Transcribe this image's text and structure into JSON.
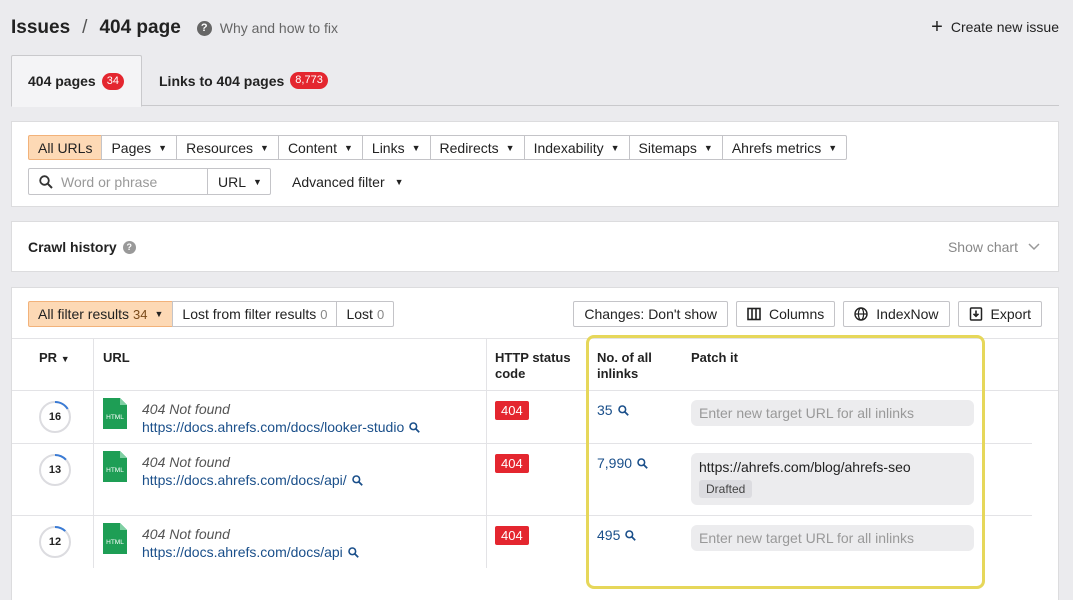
{
  "breadcrumb": {
    "root": "Issues",
    "separator": "/",
    "current": "404 page"
  },
  "help": {
    "icon": "help-circle-icon",
    "label": "Why and how to fix"
  },
  "create_issue": {
    "icon": "plus-icon",
    "label": "Create new issue"
  },
  "tabs": [
    {
      "label": "404 pages",
      "count": "34",
      "active": true
    },
    {
      "label": "Links to 404 pages",
      "count": "8,773",
      "active": false
    }
  ],
  "filters": {
    "buttons": [
      {
        "label": "All URLs",
        "selected": true,
        "caret": false
      },
      {
        "label": "Pages",
        "caret": true
      },
      {
        "label": "Resources",
        "caret": true
      },
      {
        "label": "Content",
        "caret": true
      },
      {
        "label": "Links",
        "caret": true
      },
      {
        "label": "Redirects",
        "caret": true
      },
      {
        "label": "Indexability",
        "caret": true
      },
      {
        "label": "Sitemaps",
        "caret": true
      },
      {
        "label": "Ahrefs metrics",
        "caret": true
      }
    ],
    "search_placeholder": "Word or phrase",
    "search_scope": "URL",
    "advanced_filter": "Advanced filter"
  },
  "crawl_history": {
    "title": "Crawl history",
    "show_chart": "Show chart"
  },
  "results": {
    "segments": [
      {
        "label": "All filter results",
        "count": "34",
        "selected": true
      },
      {
        "label": "Lost from filter results",
        "count": "0"
      },
      {
        "label": "Lost",
        "count": "0"
      }
    ],
    "tools": {
      "changes": "Changes: Don't show",
      "columns": "Columns",
      "indexnow": "IndexNow",
      "export": "Export"
    },
    "columns": {
      "pr": "PR",
      "url": "URL",
      "http_status_line1": "HTTP status",
      "http_status_line2": "code",
      "inlinks_line1": "No. of all",
      "inlinks_line2": "inlinks",
      "patch": "Patch it"
    },
    "rows": [
      {
        "pr": "16",
        "pr_fraction": 0.16,
        "file_type": "HTML",
        "status_text": "404 Not found",
        "url": "https://docs.ahrefs.com/docs/looker-studio",
        "code": "404",
        "inlinks": "35",
        "patch_placeholder": "Enter new target URL for all inlinks"
      },
      {
        "pr": "13",
        "pr_fraction": 0.13,
        "file_type": "HTML",
        "status_text": "404 Not found",
        "url": "https://docs.ahrefs.com/docs/api/",
        "code": "404",
        "inlinks": "7,990",
        "patch_value": "https://ahrefs.com/blog/ahrefs-seo",
        "patch_badge": "Drafted"
      },
      {
        "pr": "12",
        "pr_fraction": 0.12,
        "file_type": "HTML",
        "status_text": "404 Not found",
        "url": "https://docs.ahrefs.com/docs/api",
        "code": "404",
        "inlinks": "495",
        "patch_placeholder": "Enter new target URL for all inlinks"
      }
    ]
  },
  "colors": {
    "accent_selected": "#fdd9b5",
    "badge_red": "#e4262f",
    "link_blue": "#1a4f8a",
    "highlight_yellow": "#e6d75a",
    "file_green": "#1e9e55"
  }
}
